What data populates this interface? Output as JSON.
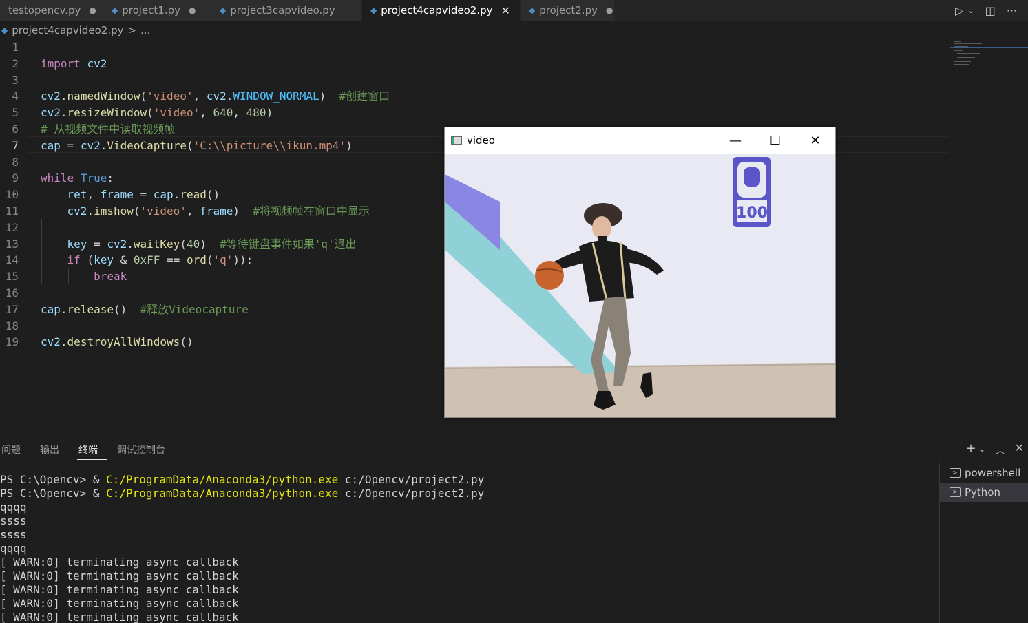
{
  "tabs": [
    {
      "label": "testopencv.py",
      "state": "modified"
    },
    {
      "label": "project1.py",
      "state": "modified"
    },
    {
      "label": "project3capvideo.py",
      "state": "clean"
    },
    {
      "label": "project4capvideo2.py",
      "state": "active"
    },
    {
      "label": "project2.py",
      "state": "modified"
    }
  ],
  "breadcrumb": {
    "file": "project4capvideo2.py",
    "sep": ">",
    "more": "..."
  },
  "editor": {
    "line_numbers": [
      "1",
      "2",
      "3",
      "4",
      "5",
      "6",
      "7",
      "8",
      "9",
      "10",
      "11",
      "12",
      "13",
      "14",
      "15",
      "16",
      "17",
      "18",
      "19"
    ],
    "current_line": 7,
    "lines": [
      [],
      [
        [
          "kw",
          "import"
        ],
        [
          "pl",
          " "
        ],
        [
          "id",
          "cv2"
        ]
      ],
      [],
      [
        [
          "id",
          "cv2"
        ],
        [
          "pl",
          "."
        ],
        [
          "fn",
          "namedWindow"
        ],
        [
          "pl",
          "("
        ],
        [
          "st",
          "'video'"
        ],
        [
          "pl",
          ", "
        ],
        [
          "id",
          "cv2"
        ],
        [
          "pl",
          "."
        ],
        [
          "co",
          "WINDOW_NORMAL"
        ],
        [
          "pl",
          ")  "
        ],
        [
          "cm",
          "#创建窗口"
        ]
      ],
      [
        [
          "id",
          "cv2"
        ],
        [
          "pl",
          "."
        ],
        [
          "fn",
          "resizeWindow"
        ],
        [
          "pl",
          "("
        ],
        [
          "st",
          "'video'"
        ],
        [
          "pl",
          ", "
        ],
        [
          "nu",
          "640"
        ],
        [
          "pl",
          ", "
        ],
        [
          "nu",
          "480"
        ],
        [
          "pl",
          ")"
        ]
      ],
      [
        [
          "cm",
          "# 从视频文件中读取视频帧"
        ]
      ],
      [
        [
          "id",
          "cap"
        ],
        [
          "pl",
          " = "
        ],
        [
          "id",
          "cv2"
        ],
        [
          "pl",
          "."
        ],
        [
          "fn",
          "VideoCapture"
        ],
        [
          "pl",
          "("
        ],
        [
          "st",
          "'C:\\\\picture\\\\ikun.mp4'"
        ],
        [
          "pl",
          ")"
        ]
      ],
      [],
      [
        [
          "kw",
          "while"
        ],
        [
          "pl",
          " "
        ],
        [
          "kb",
          "True"
        ],
        [
          "pl",
          ":"
        ]
      ],
      [
        [
          "pl",
          "    "
        ],
        [
          "id",
          "ret"
        ],
        [
          "pl",
          ", "
        ],
        [
          "id",
          "frame"
        ],
        [
          "pl",
          " = "
        ],
        [
          "id",
          "cap"
        ],
        [
          "pl",
          "."
        ],
        [
          "fn",
          "read"
        ],
        [
          "pl",
          "()"
        ]
      ],
      [
        [
          "pl",
          "    "
        ],
        [
          "id",
          "cv2"
        ],
        [
          "pl",
          "."
        ],
        [
          "fn",
          "imshow"
        ],
        [
          "pl",
          "("
        ],
        [
          "st",
          "'video'"
        ],
        [
          "pl",
          ", "
        ],
        [
          "id",
          "frame"
        ],
        [
          "pl",
          ")  "
        ],
        [
          "cm",
          "#将视频帧在窗口中显示"
        ]
      ],
      [],
      [
        [
          "pl",
          "    "
        ],
        [
          "id",
          "key"
        ],
        [
          "pl",
          " = "
        ],
        [
          "id",
          "cv2"
        ],
        [
          "pl",
          "."
        ],
        [
          "fn",
          "waitKey"
        ],
        [
          "pl",
          "("
        ],
        [
          "nu",
          "40"
        ],
        [
          "pl",
          ")  "
        ],
        [
          "cm",
          "#等待键盘事件如果'q'退出"
        ]
      ],
      [
        [
          "pl",
          "    "
        ],
        [
          "kw",
          "if"
        ],
        [
          "pl",
          " ("
        ],
        [
          "id",
          "key"
        ],
        [
          "pl",
          " & "
        ],
        [
          "nu",
          "0xFF"
        ],
        [
          "pl",
          " == "
        ],
        [
          "fn",
          "ord"
        ],
        [
          "pl",
          "("
        ],
        [
          "st",
          "'q'"
        ],
        [
          "pl",
          "))"
        ],
        [
          "pl",
          ":"
        ]
      ],
      [
        [
          "pl",
          "        "
        ],
        [
          "kw",
          "break"
        ]
      ],
      [],
      [
        [
          "id",
          "cap"
        ],
        [
          "pl",
          "."
        ],
        [
          "fn",
          "release"
        ],
        [
          "pl",
          "()  "
        ],
        [
          "cm",
          "#释放Videocapture"
        ]
      ],
      [],
      [
        [
          "id",
          "cv2"
        ],
        [
          "pl",
          "."
        ],
        [
          "fn",
          "destroyAllWindows"
        ],
        [
          "pl",
          "()"
        ]
      ]
    ]
  },
  "video_window": {
    "title": "video",
    "minimize": "—",
    "maximize": "☐",
    "close": "✕",
    "logo_text": "100"
  },
  "panel": {
    "tabs": [
      "问题",
      "输出",
      "终端",
      "调试控制台"
    ],
    "active_tab": "终端",
    "terminal_lines": [
      [
        [
          "pl",
          "PS C:\\Opencv> & "
        ],
        [
          "yel",
          "C:/ProgramData/Anaconda3/python.exe"
        ],
        [
          "pl",
          " c:/Opencv/project2.py"
        ]
      ],
      [
        [
          "pl",
          "PS C:\\Opencv> & "
        ],
        [
          "yel",
          "C:/ProgramData/Anaconda3/python.exe"
        ],
        [
          "pl",
          " c:/Opencv/project2.py"
        ]
      ],
      [
        [
          "pl",
          "qqqq"
        ]
      ],
      [
        [
          "pl",
          "ssss"
        ]
      ],
      [
        [
          "pl",
          "ssss"
        ]
      ],
      [
        [
          "pl",
          "qqqq"
        ]
      ],
      [
        [
          "pl",
          "[ WARN:0] terminating async callback"
        ]
      ],
      [
        [
          "pl",
          "[ WARN:0] terminating async callback"
        ]
      ],
      [
        [
          "pl",
          "[ WARN:0] terminating async callback"
        ]
      ],
      [
        [
          "pl",
          "[ WARN:0] terminating async callback"
        ]
      ],
      [
        [
          "pl",
          "[ WARN:0] terminating async callback"
        ]
      ]
    ],
    "terminals": [
      {
        "label": "powershell",
        "selected": false
      },
      {
        "label": "Python",
        "selected": true
      }
    ]
  },
  "colors": {
    "editor_bg": "#1e1e1e",
    "keyword": "#c586c0",
    "function": "#dcdcaa",
    "string": "#ce9178",
    "comment": "#6a9955",
    "variable": "#9cdcfe",
    "path_yellow": "#e5e510"
  }
}
